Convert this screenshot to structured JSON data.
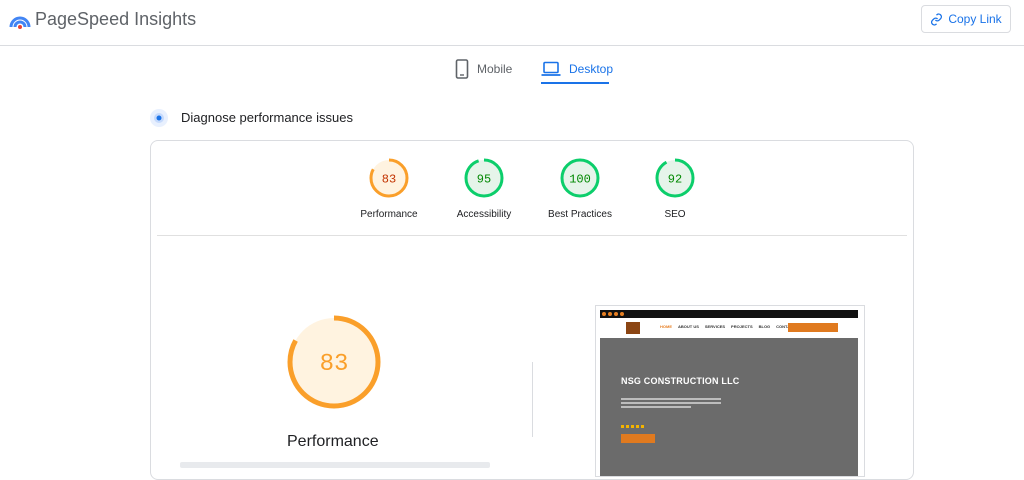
{
  "header": {
    "app_title": "PageSpeed Insights",
    "copy_link_label": "Copy Link",
    "icons": {
      "logo": "pagespeed-logo-icon",
      "copy": "link-icon"
    }
  },
  "tabs": [
    {
      "label": "Mobile",
      "icon": "smartphone-icon",
      "active": false
    },
    {
      "label": "Desktop",
      "icon": "laptop-icon",
      "active": true
    }
  ],
  "diagnose": {
    "title": "Diagnose performance issues",
    "icon": "diagnose-icon"
  },
  "scores": [
    {
      "label": "Performance",
      "value": "83",
      "fraction": 0.83,
      "color": "#fa9f2a",
      "text_color": "#c33300",
      "fill": "#fff3e0"
    },
    {
      "label": "Accessibility",
      "value": "95",
      "fraction": 0.95,
      "color": "#0cce6b",
      "text_color": "#008800",
      "fill": "#e6f4ea"
    },
    {
      "label": "Best Practices",
      "value": "100",
      "fraction": 1.0,
      "color": "#0cce6b",
      "text_color": "#008800",
      "fill": "#e6f4ea"
    },
    {
      "label": "SEO",
      "value": "92",
      "fraction": 0.92,
      "color": "#0cce6b",
      "text_color": "#008800",
      "fill": "#e6f4ea"
    }
  ],
  "performance": {
    "value": "83",
    "fraction": 0.83,
    "label": "Performance",
    "color": "#fa9f2a",
    "fill": "#fff3e0"
  },
  "screenshot": {
    "hero_title": "NSG CONSTRUCTION LLC",
    "menu": [
      "HOME",
      "ABOUT US",
      "SERVICES",
      "PROJECTS",
      "BLOG",
      "CONTACT US"
    ]
  },
  "colors": {
    "accent": "#1a73e8",
    "border": "#dadce0",
    "muted": "#5f6368"
  }
}
